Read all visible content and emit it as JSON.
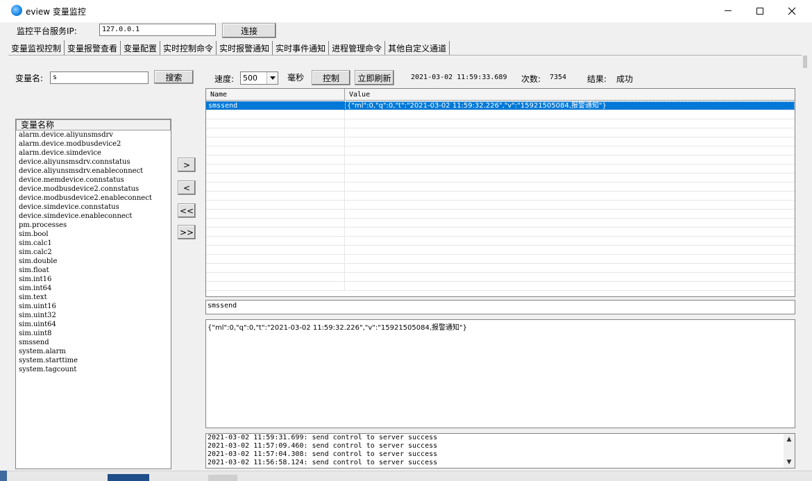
{
  "window": {
    "title": "eview 变量监控",
    "icon": "eview-app-icon"
  },
  "connection": {
    "ip_label": "监控平台服务IP:",
    "ip_value": "127.0.0.1",
    "connect_label": "连接"
  },
  "tabs": [
    {
      "label": "变量监视控制",
      "active": true
    },
    {
      "label": "变量报警查看",
      "active": false
    },
    {
      "label": "变量配置",
      "active": false
    },
    {
      "label": "实时控制命令",
      "active": false
    },
    {
      "label": "实时报警通知",
      "active": false
    },
    {
      "label": "实时事件通知",
      "active": false
    },
    {
      "label": "进程管理命令",
      "active": false
    },
    {
      "label": "其他自定义通道",
      "active": false
    }
  ],
  "search": {
    "label": "变量名:",
    "value": "s",
    "button_label": "搜索"
  },
  "variable_list": {
    "header": "变量名称",
    "items": [
      "alarm.device.aliyunsmsdrv",
      "alarm.device.modbusdevice2",
      "alarm.device.simdevice",
      "device.aliyunsmsdrv.connstatus",
      "device.aliyunsmsdrv.enableconnect",
      "device.memdevice.connstatus",
      "device.modbusdevice2.connstatus",
      "device.modbusdevice2.enableconnect",
      "device.simdevice.connstatus",
      "device.simdevice.enableconnect",
      "pm.processes",
      "sim.bool",
      "sim.calc1",
      "sim.calc2",
      "sim.double",
      "sim.float",
      "sim.int16",
      "sim.int64",
      "sim.text",
      "sim.uint16",
      "sim.uint32",
      "sim.uint64",
      "sim.uint8",
      "smssend",
      "system.alarm",
      "system.starttime",
      "system.tagcount"
    ]
  },
  "transfer_buttons": {
    "add": ">",
    "remove": "<",
    "remove_all": "<<",
    "add_all": ">>"
  },
  "controls": {
    "speed_label": "速度:",
    "speed_value": "500",
    "unit_label": "毫秒",
    "control_button": "控制",
    "refresh_button": "立即刷新",
    "timestamp": "2021-03-02 11:59:33.689",
    "count_label": "次数:",
    "count_value": "7354",
    "result_label": "结果:",
    "result_value": "成功"
  },
  "grid": {
    "columns": [
      "Name",
      "Value"
    ],
    "rows": [
      {
        "name": "smssend",
        "value": "{\"ml\":0,\"q\":0,\"t\":\"2021-03-02 11:59:32.226\",\"v\":\"15921505084,报警通知\"}",
        "selected": true
      }
    ]
  },
  "selected_name": "smssend",
  "selected_value": "{\"ml\":0,\"q\":0,\"t\":\"2021-03-02 11:59:32.226\",\"v\":\"15921505084,报警通知\"}",
  "log": {
    "lines": [
      "2021-03-02 11:59:31.699: send control to server success",
      "2021-03-02 11:57:09.460: send control to server success",
      "2021-03-02 11:57:04.308: send control to server success",
      "2021-03-02 11:56:58.124: send control to server success"
    ]
  },
  "colors": {
    "selection": "#0078d7",
    "window_bg": "#f0f0f0"
  }
}
